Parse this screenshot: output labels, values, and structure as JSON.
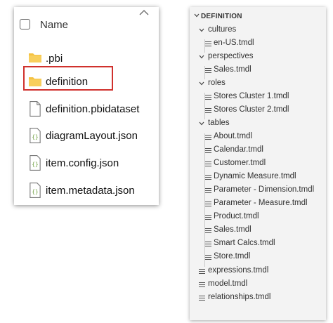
{
  "file_explorer": {
    "column_header": "Name",
    "items": [
      {
        "label": ".pbi",
        "icon": "folder-icon"
      },
      {
        "label": "definition",
        "icon": "folder-icon"
      },
      {
        "label": "definition.pbidataset",
        "icon": "file-icon"
      },
      {
        "label": "diagramLayout.json",
        "icon": "json-file-icon"
      },
      {
        "label": "item.config.json",
        "icon": "json-file-icon"
      },
      {
        "label": "item.metadata.json",
        "icon": "json-file-icon"
      }
    ]
  },
  "vscode_explorer": {
    "section_title": "DEFINITION",
    "tree": {
      "cultures_label": "cultures",
      "cultures_files": [
        "en-US.tmdl"
      ],
      "perspectives_label": "perspectives",
      "perspectives_files": [
        "Sales.tmdl"
      ],
      "roles_label": "roles",
      "roles_files": [
        "Stores Cluster 1.tmdl",
        "Stores Cluster 2.tmdl"
      ],
      "tables_label": "tables",
      "tables_files": [
        "About.tmdl",
        "Calendar.tmdl",
        "Customer.tmdl",
        "Dynamic Measure.tmdl",
        "Parameter - Dimension.tmdl",
        "Parameter - Measure.tmdl",
        "Product.tmdl",
        "Sales.tmdl",
        "Smart Calcs.tmdl",
        "Store.tmdl"
      ],
      "root_files": [
        "expressions.tmdl",
        "model.tmdl",
        "relationships.tmdl"
      ]
    }
  },
  "colors": {
    "folder": "#f5c242",
    "highlight_border": "#d0312d",
    "json_icon": "#6a9c3a"
  }
}
